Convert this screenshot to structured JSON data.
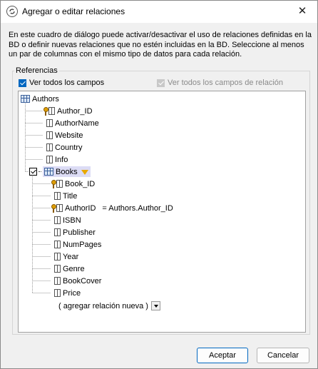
{
  "window": {
    "title": "Agregar o editar relaciones",
    "close_glyph": "✕"
  },
  "description": "En este cuadro de diálogo puede activar/desactivar el uso de relaciones definidas en la BD o definir nuevas relaciones que no estén incluidas en la BD. Seleccione al menos un par de columnas con el mismo tipo de datos para cada relación.",
  "references": {
    "label": "Referencias",
    "show_all_fields": {
      "label": "Ver todos los campos",
      "checked": true
    },
    "show_all_relation_fields": {
      "label": "Ver todos los campos de relación",
      "checked": true,
      "disabled": true
    }
  },
  "tree": {
    "root": {
      "name": "Authors",
      "icon": "table-icon",
      "fields": [
        {
          "name": "Author_ID",
          "key": true
        },
        {
          "name": "AuthorName",
          "key": false
        },
        {
          "name": "Website",
          "key": false
        },
        {
          "name": "Country",
          "key": false
        },
        {
          "name": "Info",
          "key": false
        }
      ]
    },
    "child": {
      "name": "Books",
      "checked": true,
      "icon": "table-icon",
      "filter_icon": "filter-icon",
      "fields": [
        {
          "name": "Book_ID",
          "key": true,
          "relation": ""
        },
        {
          "name": "Title",
          "key": false,
          "relation": ""
        },
        {
          "name": "AuthorID",
          "key": true,
          "relation": "= Authors.Author_ID"
        },
        {
          "name": "ISBN",
          "key": false,
          "relation": ""
        },
        {
          "name": "Publisher",
          "key": false,
          "relation": ""
        },
        {
          "name": "NumPages",
          "key": false,
          "relation": ""
        },
        {
          "name": "Year",
          "key": false,
          "relation": ""
        },
        {
          "name": "Genre",
          "key": false,
          "relation": ""
        },
        {
          "name": "BookCover",
          "key": false,
          "relation": ""
        },
        {
          "name": "Price",
          "key": false,
          "relation": ""
        }
      ]
    },
    "add_relation": "( agregar relación nueva )"
  },
  "buttons": {
    "accept": "Aceptar",
    "cancel": "Cancelar"
  },
  "colors": {
    "accent": "#0067c0",
    "highlight": "#dcdcf5",
    "filter": "#e8a800"
  }
}
